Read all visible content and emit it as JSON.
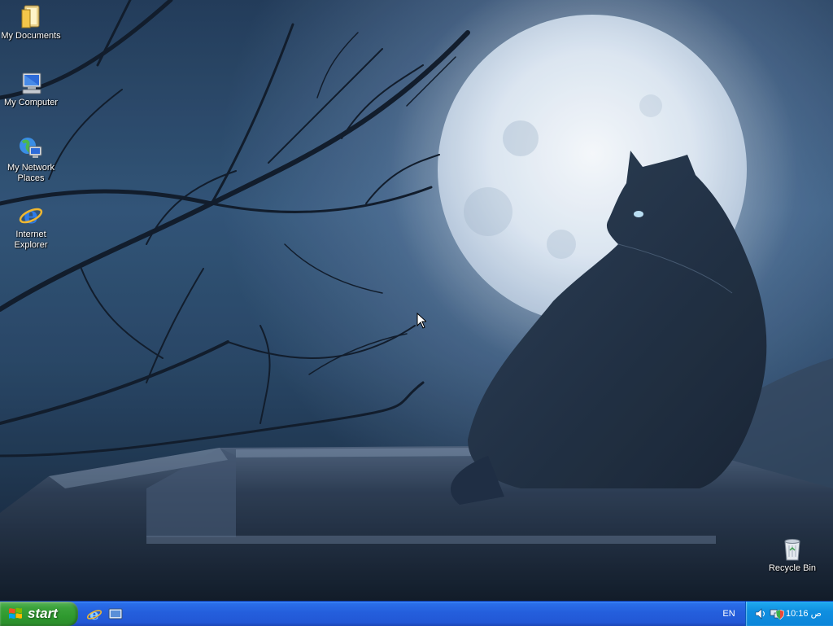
{
  "desktop": {
    "icons": [
      {
        "label": "My Documents",
        "icon": "my-documents-icon"
      },
      {
        "label": "My Computer",
        "icon": "my-computer-icon"
      },
      {
        "label": "My Network Places",
        "icon": "my-network-places-icon"
      },
      {
        "label": "Internet Explorer",
        "icon": "internet-explorer-icon"
      },
      {
        "label": "Recycle Bin",
        "icon": "recycle-bin-icon"
      }
    ]
  },
  "taskbar": {
    "start_label": "start",
    "quick_launch": [
      "internet-explorer-icon",
      "show-desktop-icon"
    ],
    "language": "EN",
    "clock": "10:16 ص",
    "tray_icons": [
      "volume-icon",
      "network-icon",
      "security-shield-icon"
    ]
  },
  "colors": {
    "taskbar_blue": "#245edc",
    "start_green": "#3ba23b",
    "tray_blue": "#0f8fe0"
  }
}
